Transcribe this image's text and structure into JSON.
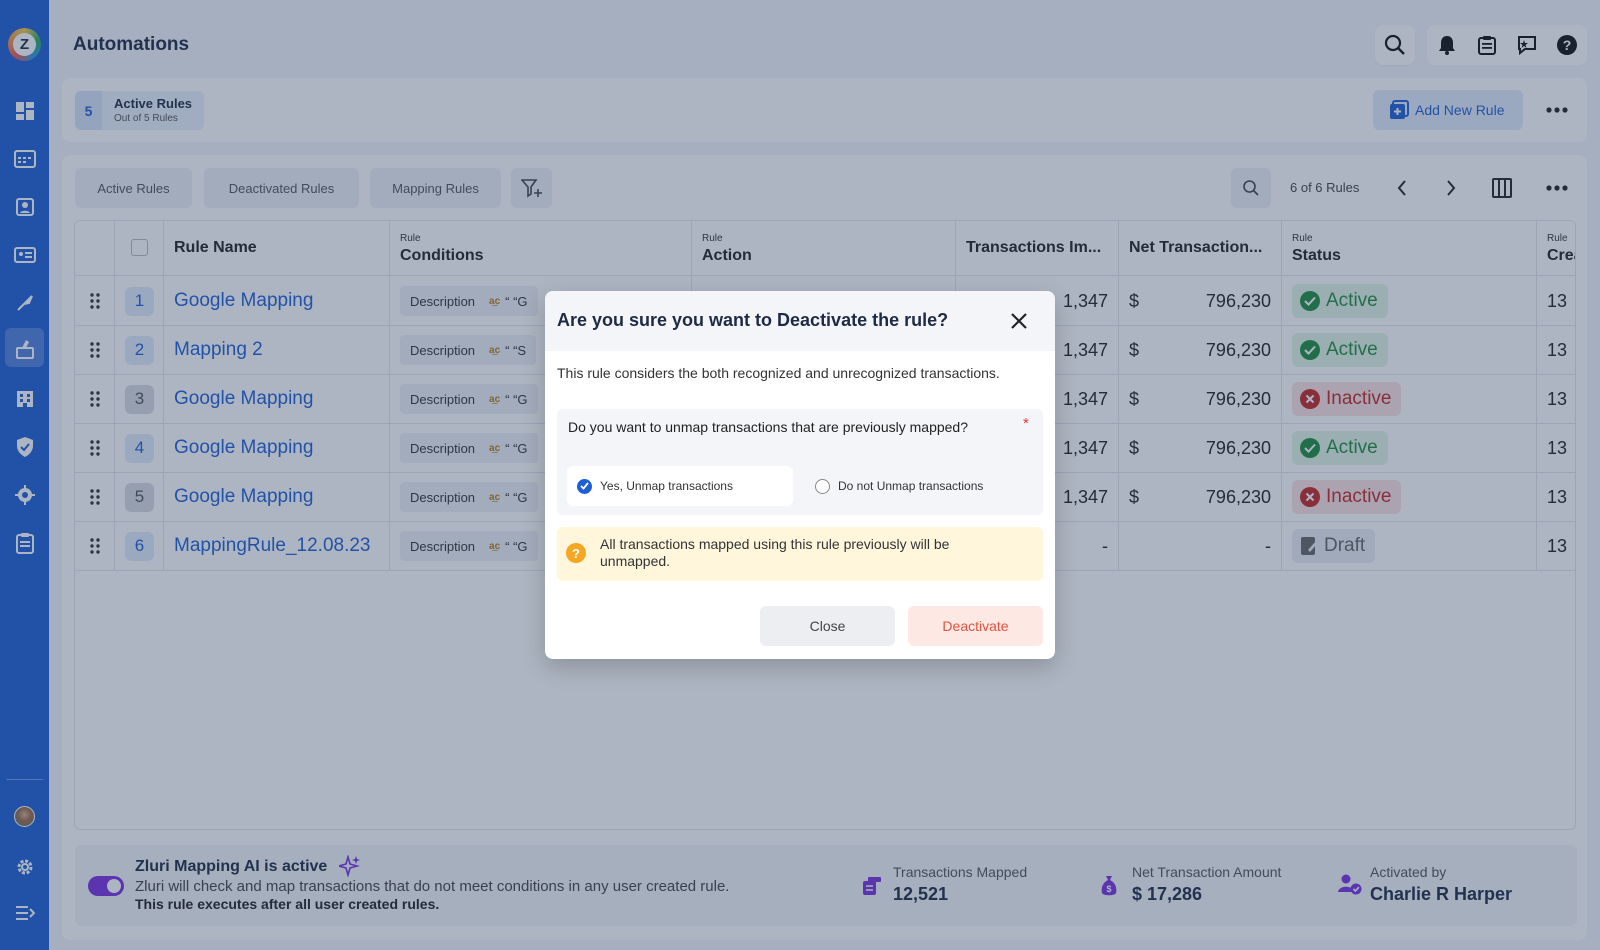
{
  "app": {
    "title": "Automations",
    "logo_letter": "Z"
  },
  "sidebar": {
    "items": [
      {
        "icon": "dashboard-icon"
      },
      {
        "icon": "applications-icon"
      },
      {
        "icon": "users-icon"
      },
      {
        "icon": "contracts-icon"
      },
      {
        "icon": "workflows-icon"
      },
      {
        "icon": "automations-icon",
        "active": true
      },
      {
        "icon": "vendors-icon"
      },
      {
        "icon": "security-icon"
      },
      {
        "icon": "integrations-icon"
      },
      {
        "icon": "reports-icon"
      }
    ],
    "bottom": [
      {
        "icon": "avatar"
      },
      {
        "icon": "gear-icon"
      },
      {
        "icon": "collapse-icon"
      }
    ]
  },
  "header_actions": [
    "search-icon",
    "bell-icon",
    "clipboard-icon",
    "feedback-icon",
    "help-icon"
  ],
  "summary": {
    "count": "5",
    "title": "Active Rules",
    "subtitle": "Out of 5 Rules",
    "add_label": "Add New Rule"
  },
  "tabs": [
    "Active Rules",
    "Deactivated Rules",
    "Mapping Rules"
  ],
  "pager": {
    "text": "6 of 6 Rules"
  },
  "table": {
    "columns": {
      "rule_name": "Rule Name",
      "conditions_small": "Rule",
      "conditions": "Conditions",
      "action_small": "Rule",
      "action": "Action",
      "transactions": "Transactions Im...",
      "net_transaction": "Net Transaction...",
      "status_small": "Rule",
      "status": "Status",
      "created_small": "Rule",
      "created": "Crea"
    },
    "rows": [
      {
        "num": "1",
        "name": "Google Mapping",
        "cond_field": "Description",
        "cond_value": "“ “G",
        "transactions": "1,347",
        "currency": "$",
        "amount": "796,230",
        "status": "Active",
        "created": "13"
      },
      {
        "num": "2",
        "name": "Mapping 2",
        "cond_field": "Description",
        "cond_value": "“ “S",
        "transactions": "1,347",
        "currency": "$",
        "amount": "796,230",
        "status": "Active",
        "created": "13"
      },
      {
        "num": "3",
        "name": "Google Mapping",
        "cond_field": "Description",
        "cond_value": "“ “G",
        "transactions": "1,347",
        "currency": "$",
        "amount": "796,230",
        "status": "Inactive",
        "created": "13"
      },
      {
        "num": "4",
        "name": "Google Mapping",
        "cond_field": "Description",
        "cond_value": "“ “G",
        "transactions": "1,347",
        "currency": "$",
        "amount": "796,230",
        "status": "Active",
        "created": "13"
      },
      {
        "num": "5",
        "name": "Google Mapping",
        "cond_field": "Description",
        "cond_value": "“ “G",
        "transactions": "1,347",
        "currency": "$",
        "amount": "796,230",
        "status": "Inactive",
        "created": "13"
      },
      {
        "num": "6",
        "name": "MappingRule_12.08.23",
        "cond_field": "Description",
        "cond_value": "“ “G",
        "transactions": "-",
        "currency": "",
        "amount": "-",
        "status": "Draft",
        "created": "13"
      }
    ]
  },
  "ai_bar": {
    "title": "Zluri Mapping AI is active",
    "description": "Zluri will check and map transactions that do not meet conditions in any user created rule.",
    "note": "This rule executes after all user created rules.",
    "stats": [
      {
        "label": "Transactions Mapped",
        "value": "12,521",
        "icon": "transactions-icon"
      },
      {
        "label": "Net Transaction Amount",
        "value": "$ 17,286",
        "icon": "money-bag-icon"
      },
      {
        "label": "Activated by",
        "value": "Charlie R Harper",
        "icon": "user-check-icon"
      }
    ]
  },
  "modal": {
    "title": "Are you sure you want to Deactivate the rule?",
    "description": "This rule considers the both recognized and unrecognized transactions.",
    "question": "Do you want to unmap transactions that are previously mapped?",
    "required_mark": "*",
    "options": [
      {
        "label": "Yes, Unmap transactions",
        "selected": true
      },
      {
        "label": "Do not Unmap transactions",
        "selected": false
      }
    ],
    "warning": "All transactions mapped using this rule previously will be unmapped.",
    "warning_icon": "?",
    "close_label": "Close",
    "deactivate_label": "Deactivate"
  },
  "colors": {
    "primary": "#1f5fd6",
    "active": "#1e8e3e",
    "inactive": "#c62828",
    "ai": "#7b2fe3",
    "danger": "#e0533f"
  }
}
